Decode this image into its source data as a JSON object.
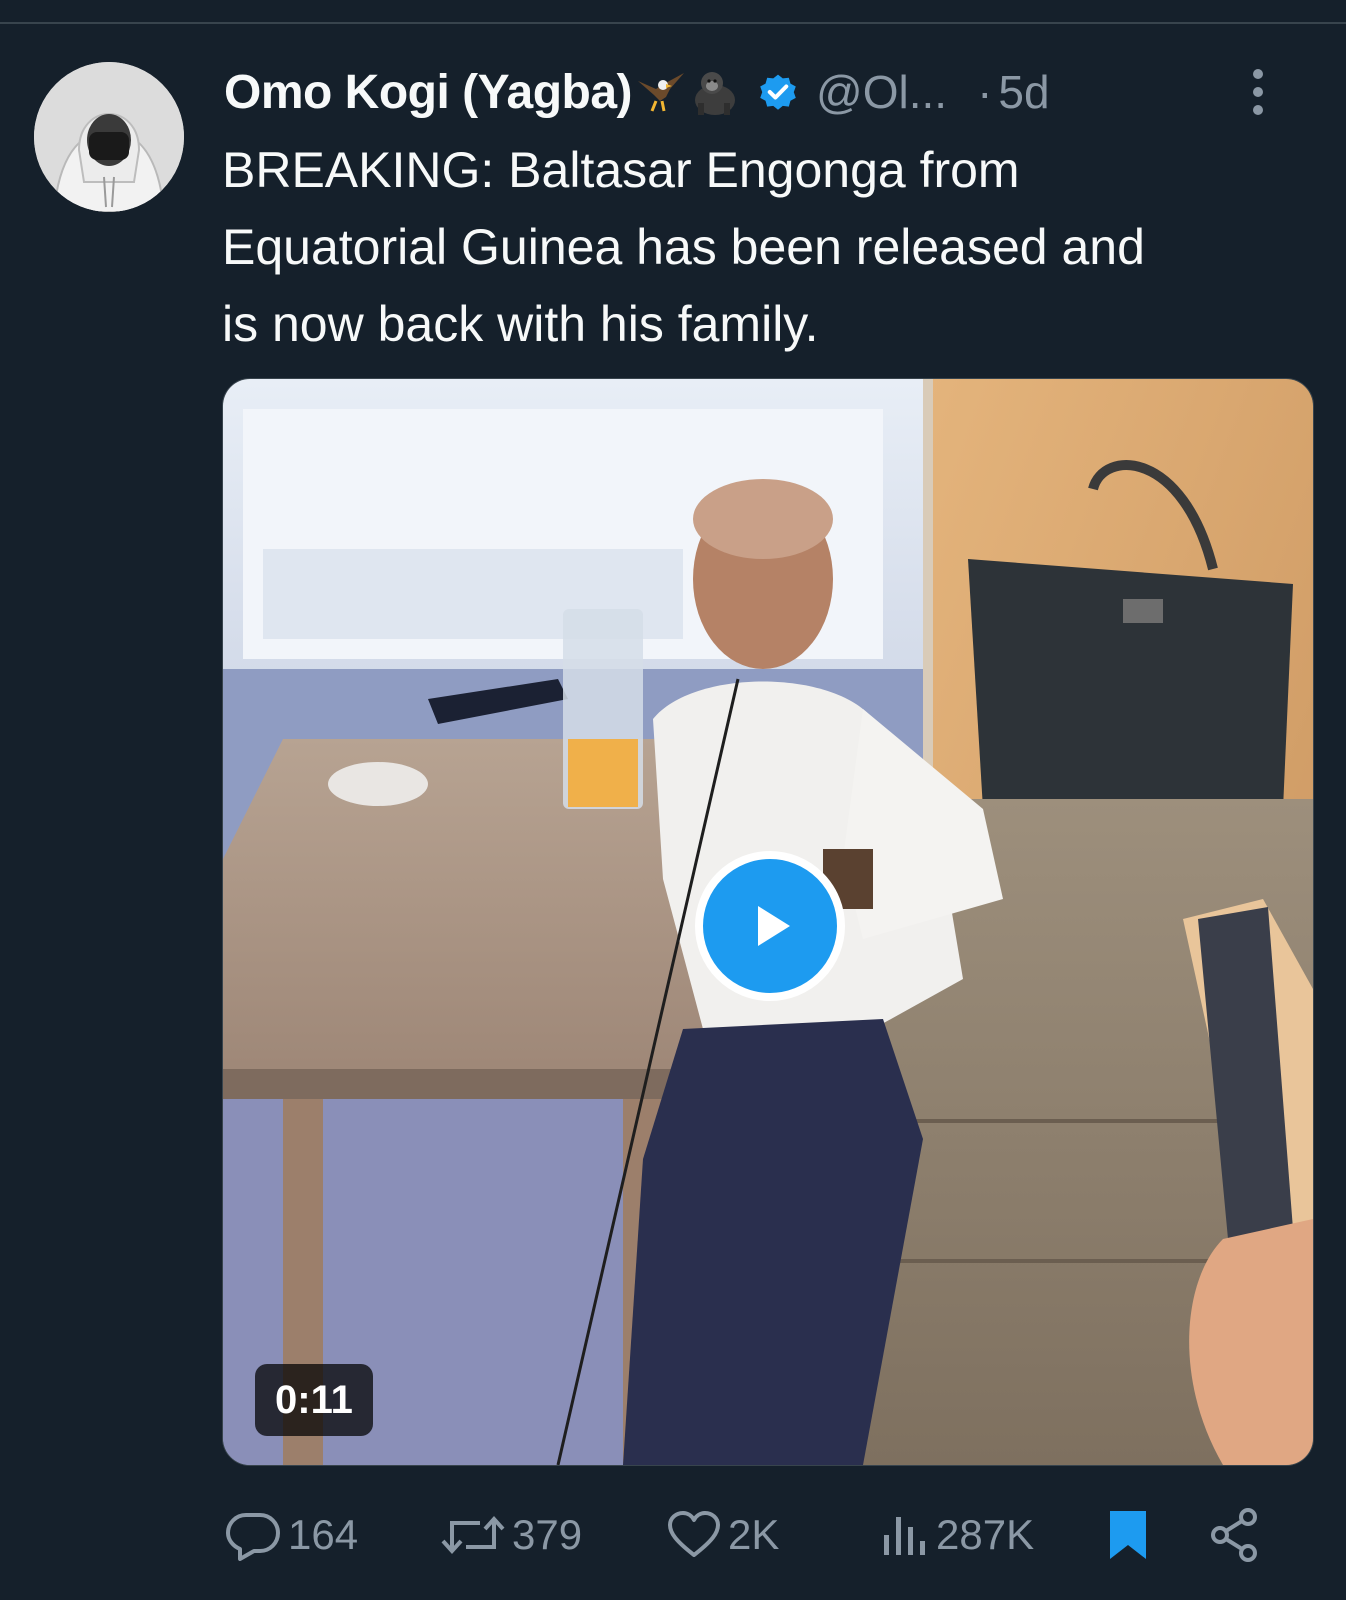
{
  "tweet": {
    "author": {
      "display_name": "Omo Kogi (Yagba)",
      "emojis": [
        "eagle-emoji",
        "gorilla-emoji"
      ],
      "verified": true,
      "handle": "@Ol...",
      "separator": "·",
      "time": "5d"
    },
    "text_lines": [
      "BREAKING: Baltasar Engonga from",
      "Equatorial Guinea has been released and",
      "is now back with his family."
    ],
    "media": {
      "type": "video",
      "duration": "0:11"
    },
    "actions": {
      "replies": "164",
      "reposts": "379",
      "likes": "2K",
      "views": "287K"
    }
  },
  "colors": {
    "background": "#15202b",
    "text": "#f7f9f9",
    "muted": "#8b98a5",
    "accent": "#1d9bf0"
  },
  "icons": [
    "more-icon",
    "verified-badge-icon",
    "play-icon",
    "reply-icon",
    "repost-icon",
    "like-icon",
    "views-icon",
    "bookmark-icon",
    "share-icon"
  ]
}
